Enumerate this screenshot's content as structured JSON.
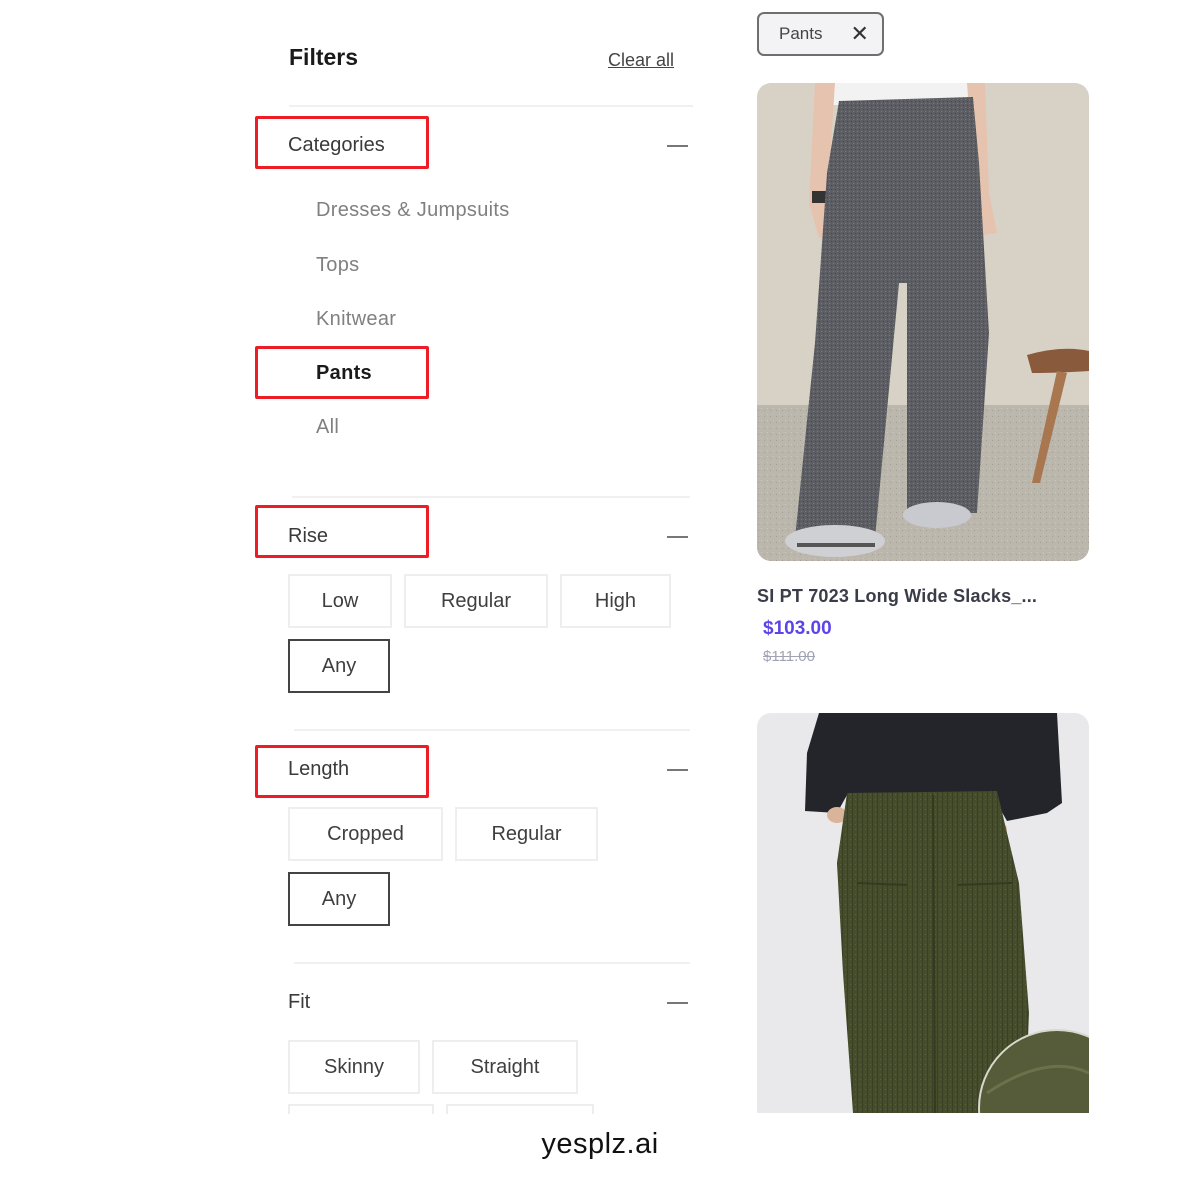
{
  "filters": {
    "title": "Filters",
    "clear_all_label": "Clear all",
    "categories": {
      "title": "Categories",
      "items": [
        {
          "label": "Dresses & Jumpsuits",
          "active": false
        },
        {
          "label": "Tops",
          "active": false
        },
        {
          "label": "Knitwear",
          "active": false
        },
        {
          "label": "Pants",
          "active": true
        },
        {
          "label": "All",
          "active": false
        }
      ]
    },
    "rise": {
      "title": "Rise",
      "options": [
        "Low",
        "Regular",
        "High",
        "Any"
      ],
      "selected": "Any"
    },
    "length": {
      "title": "Length",
      "options": [
        "Cropped",
        "Regular",
        "Any"
      ],
      "selected": "Any"
    },
    "fit": {
      "title": "Fit",
      "options": [
        "Skinny",
        "Straight"
      ]
    },
    "collapse_icon": "minus-icon"
  },
  "active_filter_chip": {
    "label": "Pants",
    "remove_icon": "close-icon",
    "remove_glyph": "✕"
  },
  "products": [
    {
      "name": "SI PT 7023 Long Wide Slacks_...",
      "sale_price": "$103.00",
      "original_price": "$111.00",
      "image": "grey-wide-slacks-photo"
    },
    {
      "image": "olive-corduroy-pants-photo"
    }
  ],
  "colors": {
    "highlight": "#ee1c25",
    "sale_price": "#5b45e9",
    "original_price": "#a0a4b2"
  },
  "brand": "yesplz.ai"
}
